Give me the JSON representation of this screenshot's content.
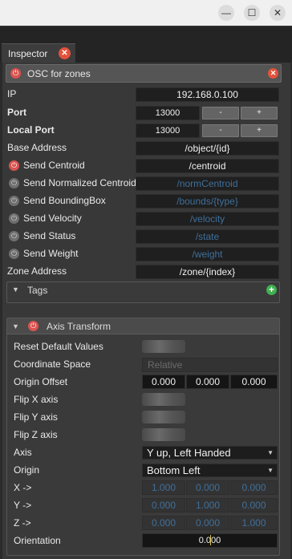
{
  "window": {
    "minimize_glyph": "—",
    "maximize_glyph": "☐",
    "close_glyph": "✕"
  },
  "tab": {
    "label": "Inspector",
    "close_glyph": "✕"
  },
  "component": {
    "title": "OSC for zones"
  },
  "rows": {
    "ip": {
      "label": "IP",
      "value": "192.168.0.100"
    },
    "port": {
      "label": "Port",
      "value": "13000",
      "minus": "-",
      "plus": "+"
    },
    "local_port": {
      "label": "Local Port",
      "value": "13000",
      "minus": "-",
      "plus": "+"
    },
    "base_address": {
      "label": "Base Address",
      "value": "/object/{id}"
    },
    "send_centroid": {
      "label": "Send Centroid",
      "value": "/centroid"
    },
    "send_norm_centroid": {
      "label": "Send Normalized Centroid",
      "value": "/normCentroid"
    },
    "send_bbox": {
      "label": "Send BoundingBox",
      "value": "/bounds/{type}"
    },
    "send_velocity": {
      "label": "Send Velocity",
      "value": "/velocity"
    },
    "send_status": {
      "label": "Send Status",
      "value": "/state"
    },
    "send_weight": {
      "label": "Send Weight",
      "value": "/weight"
    },
    "zone_address": {
      "label": "Zone Address",
      "value": "/zone/{index}"
    }
  },
  "tags": {
    "title": "Tags"
  },
  "axis": {
    "title": "Axis Transform",
    "reset_label": "Reset Default Values",
    "coord_label": "Coordinate Space",
    "coord_value": "Relative",
    "origin_offset_label": "Origin Offset",
    "origin_offset": [
      "0.000",
      "0.000",
      "0.000"
    ],
    "flip_x": "Flip X axis",
    "flip_y": "Flip Y axis",
    "flip_z": "Flip Z axis",
    "axis_label": "Axis",
    "axis_value": "Y up, Left Handed",
    "origin_label": "Origin",
    "origin_value": "Bottom Left",
    "x_label": "X ->",
    "x_vals": [
      "1.000",
      "0.000",
      "0.000"
    ],
    "y_label": "Y ->",
    "y_vals": [
      "0.000",
      "1.000",
      "0.000"
    ],
    "z_label": "Z ->",
    "z_vals": [
      "0.000",
      "0.000",
      "1.000"
    ],
    "orientation_label": "Orientation",
    "orientation_value": "0.000"
  },
  "colors": {
    "accent_red": "#d9534f",
    "add_green": "#3fb050",
    "disabled_text": "#3f6f9a"
  }
}
